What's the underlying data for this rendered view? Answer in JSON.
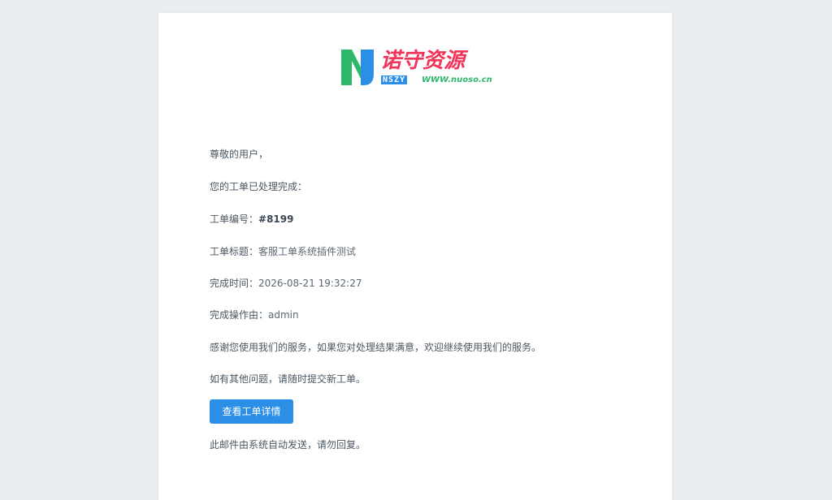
{
  "logo": {
    "title": "诺守资源",
    "abbr": "NSZY",
    "url": "WWW.nuoso.cn",
    "colors": {
      "green": "#2fb76a",
      "blue": "#2b8fe8",
      "red": "#f0355a"
    }
  },
  "email": {
    "greeting": "尊敬的用户，",
    "intro": "您的工单已处理完成：",
    "ticket_no_label": "工单编号：",
    "ticket_no": "#8199",
    "ticket_title_label": "工单标题：",
    "ticket_title": "客服工单系统插件测试",
    "finish_time_label": "完成时间：",
    "finish_time": "2026-08-21 19:32:27",
    "operator_label": "完成操作由：",
    "operator": "admin",
    "thanks": "感谢您使用我们的服务，如果您对处理结果满意，欢迎继续使用我们的服务。",
    "more": "如有其他问题，请随时提交新工单。",
    "button_label": "查看工单详情",
    "footer": "此邮件由系统自动发送，请勿回复。"
  },
  "colors": {
    "page_bg": "#e9eef2",
    "card_bg": "#ffffff",
    "accent": "#2b8fe8",
    "text": "#4a5763"
  }
}
